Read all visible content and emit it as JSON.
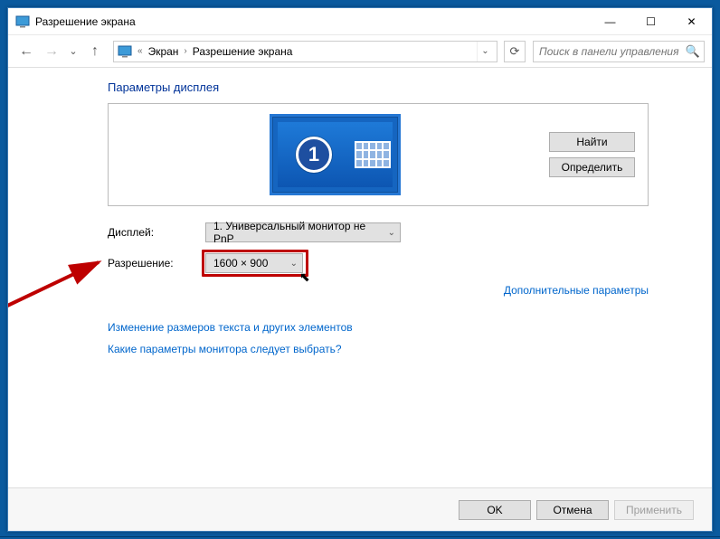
{
  "window": {
    "title": "Разрешение экрана"
  },
  "titlebar_controls": {
    "minimize": "—",
    "maximize": "☐",
    "close": "✕"
  },
  "breadcrumb": {
    "items": [
      "Экран",
      "Разрешение экрана"
    ]
  },
  "search": {
    "placeholder": "Поиск в панели управления"
  },
  "content": {
    "heading": "Параметры дисплея",
    "monitor_badge": "1",
    "buttons": {
      "find": "Найти",
      "detect": "Определить"
    },
    "rows": {
      "display_label": "Дисплей:",
      "display_value": "1. Универсальный монитор не PnP",
      "resolution_label": "Разрешение:",
      "resolution_value": "1600 × 900"
    },
    "advanced_link": "Дополнительные параметры",
    "links": {
      "text_size": "Изменение размеров текста и других элементов",
      "which_settings": "Какие параметры монитора следует выбрать?"
    }
  },
  "footer": {
    "ok": "OK",
    "cancel": "Отмена",
    "apply": "Применить"
  }
}
